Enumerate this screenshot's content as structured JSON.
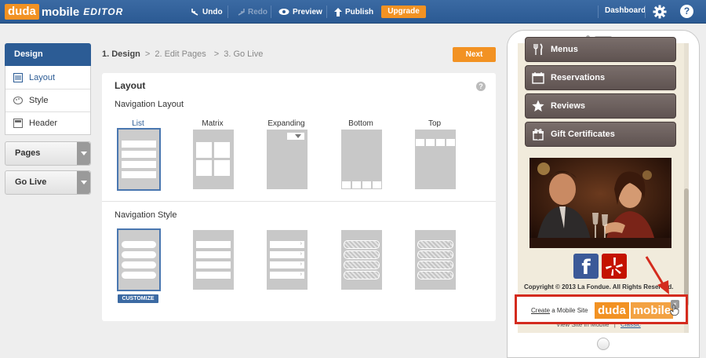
{
  "topbar": {
    "logo_duda": "duda",
    "logo_mobile": "mobile",
    "logo_editor": "EDITOR",
    "undo": "Undo",
    "redo": "Redo",
    "preview": "Preview",
    "publish": "Publish",
    "upgrade": "Upgrade",
    "dashboard": "Dashboard",
    "help": "?"
  },
  "sidebar": {
    "design": "Design",
    "items": [
      {
        "label": "Layout",
        "icon": "layout-icon"
      },
      {
        "label": "Style",
        "icon": "palette-icon"
      },
      {
        "label": "Header",
        "icon": "header-icon"
      }
    ],
    "pages": "Pages",
    "go_live": "Go Live"
  },
  "breadcrumb": {
    "step1": "1. Design",
    "sep": ">",
    "step2": "2. Edit Pages",
    "step3": "3. Go Live"
  },
  "next_label": "Next",
  "panel": {
    "title": "Layout",
    "help": "?",
    "nav_layout_label": "Navigation Layout",
    "nav_style_label": "Navigation Style",
    "layouts": [
      "List",
      "Matrix",
      "Expanding",
      "Bottom",
      "Top"
    ],
    "selected_layout": "List",
    "customize": "CUSTOMIZE"
  },
  "preview": {
    "menu_items": [
      {
        "label": "Menus",
        "icon": "fork-knife-icon"
      },
      {
        "label": "Reservations",
        "icon": "calendar-icon"
      },
      {
        "label": "Reviews",
        "icon": "star-icon"
      },
      {
        "label": "Gift Certificates",
        "icon": "gift-icon"
      }
    ],
    "facebook": "f",
    "copyright": "Copyright © 2013 La Fondue. All Rights Reserved.",
    "view_prefix": "View Site in Mobile",
    "view_sep": "|",
    "classic": "Classic",
    "banner_create": "Create",
    "banner_rest": " a Mobile Site",
    "banner_duda": "duda",
    "banner_mobile": "mobile",
    "banner_close": "×"
  },
  "colors": {
    "brand_blue": "#2c5c95",
    "brand_orange": "#f29223",
    "highlight_red": "#d42b1e"
  }
}
